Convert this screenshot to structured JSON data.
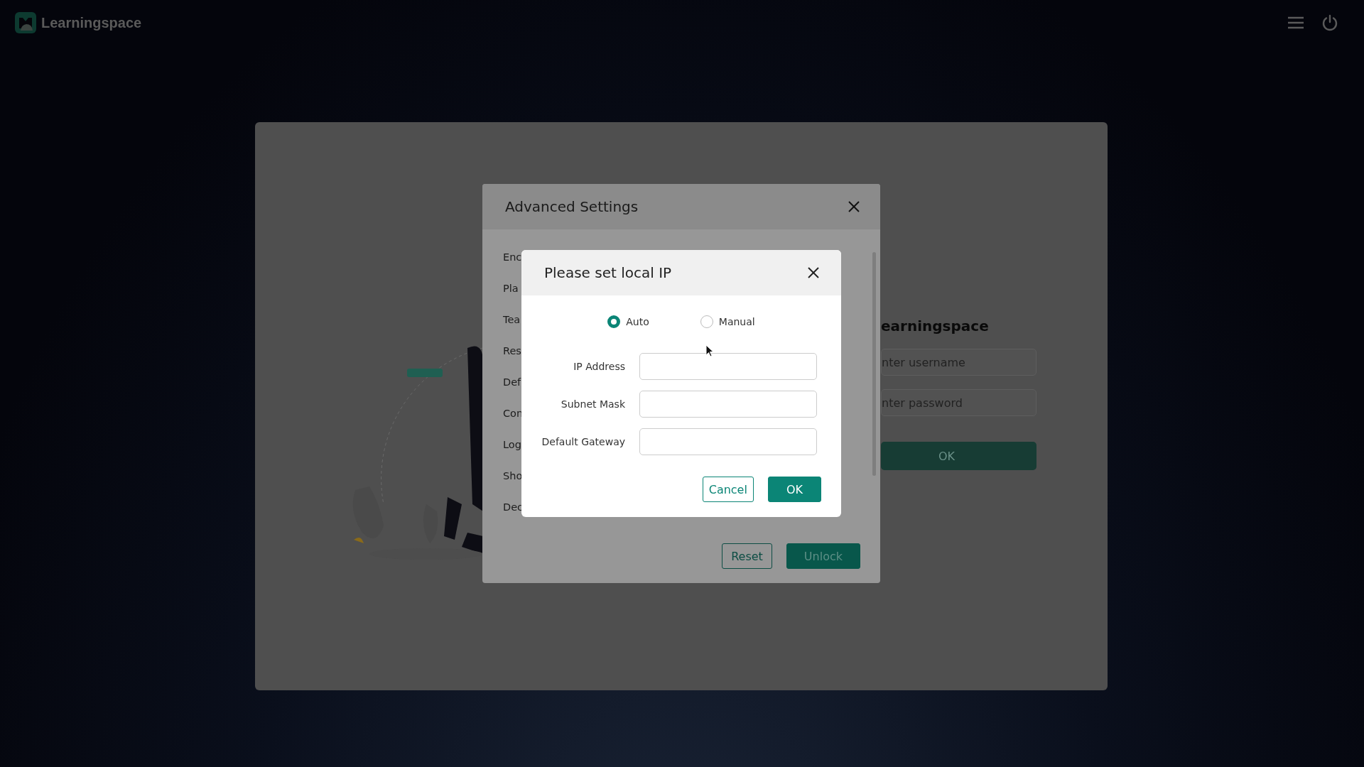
{
  "app": {
    "name": "Learningspace"
  },
  "login": {
    "title": "earningspace",
    "username_placeholder": "nter username",
    "password_placeholder": "nter password",
    "submit": "OK"
  },
  "advanced_settings": {
    "title": "Advanced Settings",
    "items": [
      "Enc",
      "Pla",
      "Tea",
      "Res",
      "Def",
      "Con",
      "Log",
      "Sho",
      "Dec"
    ],
    "buttons": [
      {
        "label": "Reset",
        "kind": "secondary"
      },
      {
        "label": "Unlock",
        "kind": "primary"
      }
    ]
  },
  "ip_dialog": {
    "title": "Please set local IP",
    "modes": [
      {
        "label": "Auto",
        "selected": true
      },
      {
        "label": "Manual",
        "selected": false
      }
    ],
    "fields": [
      {
        "label": "IP Address"
      },
      {
        "label": "Subnet Mask"
      },
      {
        "label": "Default Gateway"
      }
    ],
    "buttons": [
      {
        "label": "Cancel",
        "kind": "secondary"
      },
      {
        "label": "OK",
        "kind": "primary"
      }
    ]
  }
}
